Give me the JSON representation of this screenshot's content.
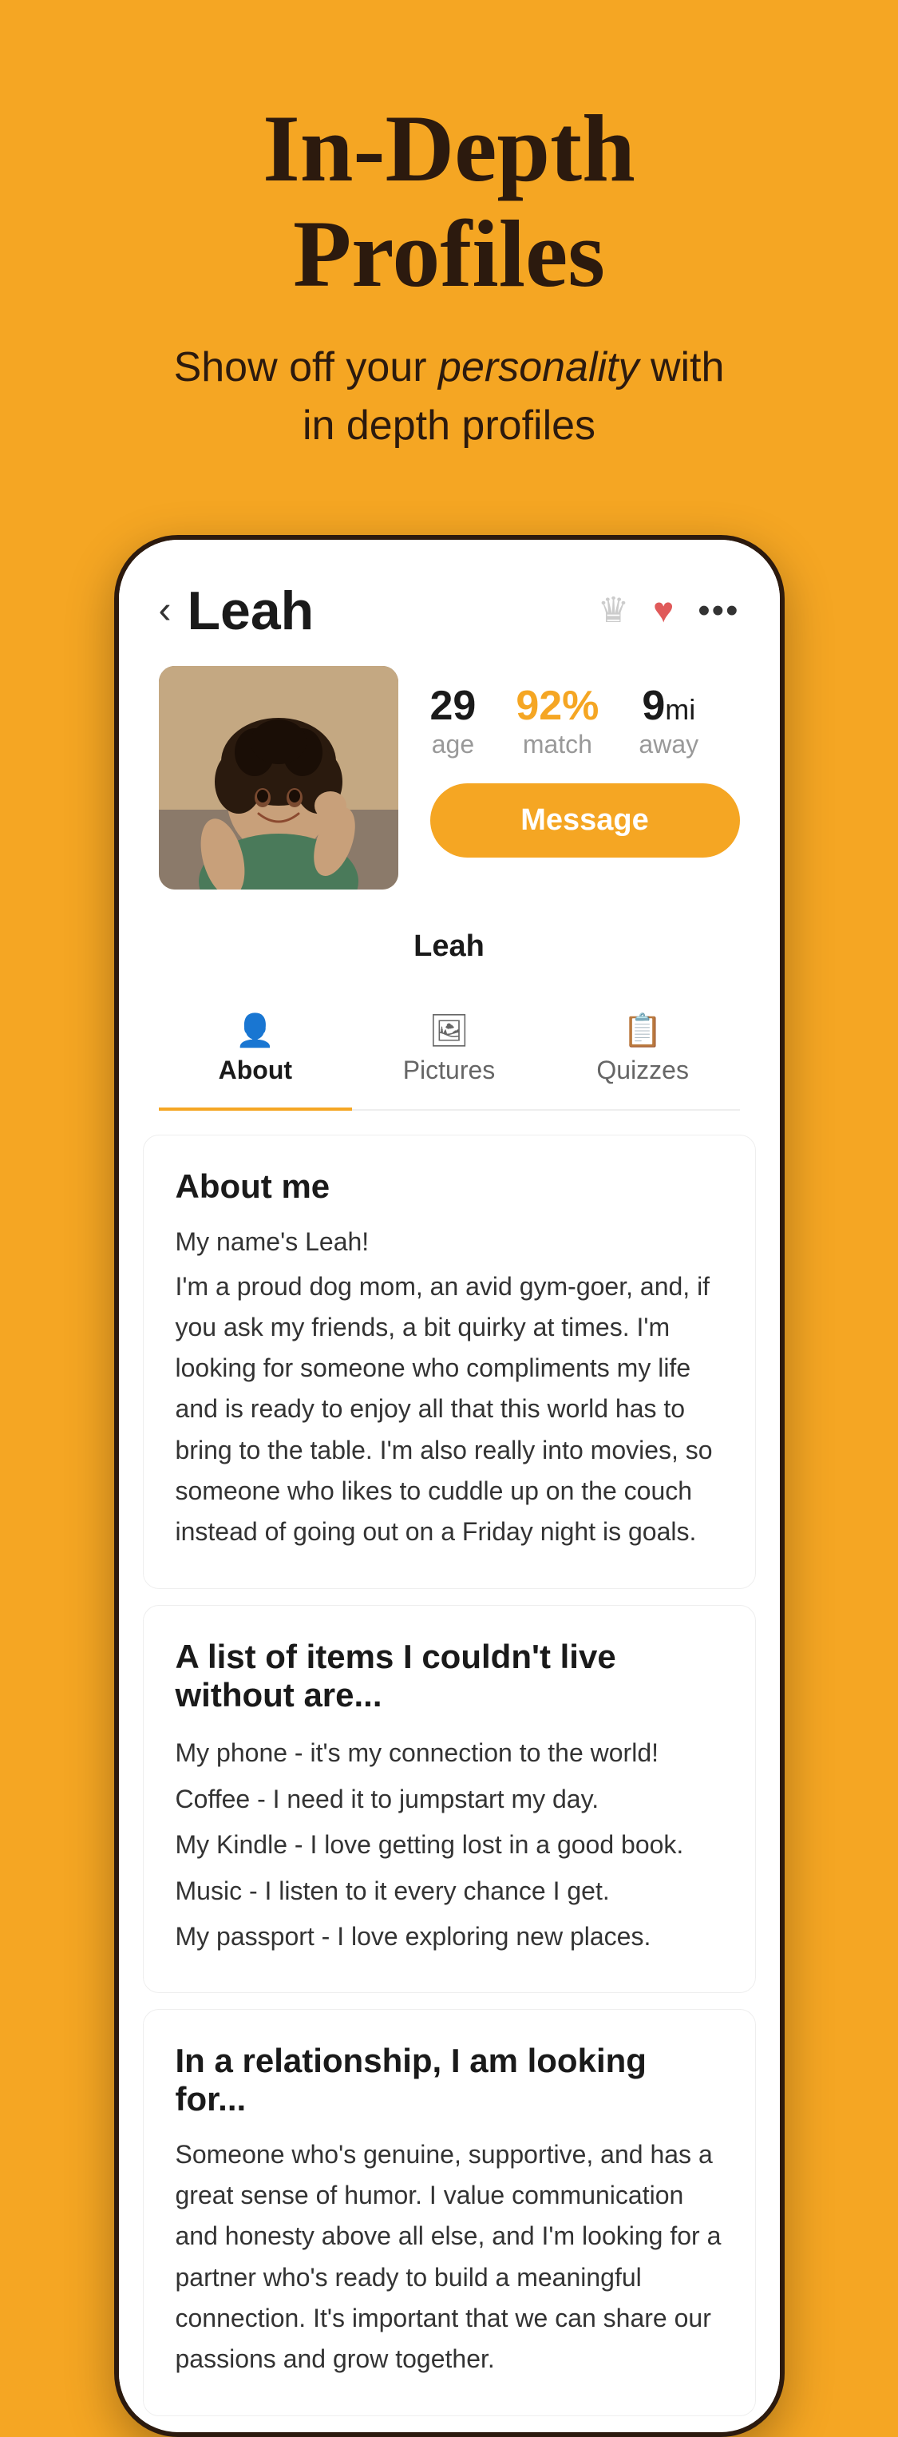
{
  "hero": {
    "title": "In-Depth\nProfiles",
    "subtitle_plain": "Show off your ",
    "subtitle_italic": "personality",
    "subtitle_end": " with\nin depth profiles"
  },
  "profile": {
    "name": "Leah",
    "age": "29",
    "age_label": "age",
    "match": "92%",
    "match_label": "match",
    "distance": "9",
    "distance_unit": "mi",
    "distance_label": "away",
    "message_button": "Message",
    "back_label": "‹",
    "more_label": "···"
  },
  "tabs": [
    {
      "label": "About",
      "icon": "👤",
      "active": true
    },
    {
      "label": "Pictures",
      "icon": "🖼",
      "active": false
    },
    {
      "label": "Quizzes",
      "icon": "📋",
      "active": false
    }
  ],
  "sections": [
    {
      "title": "About me",
      "content": "My name's Leah!\nI'm a proud dog mom, an avid gym-goer, and, if you ask my friends, a bit quirky at times. I'm looking for someone who compliments my life and is ready to enjoy all that this world has to bring to the table. I'm also really into movies, so someone who likes to cuddle up on the couch instead of going out on a Friday night is goals."
    },
    {
      "title": "A list of items I couldn't live without are...",
      "items": [
        "My phone - it's my connection to the world!",
        "Coffee - I need it to jumpstart my day.",
        "My Kindle - I love getting lost in a good book.",
        "Music - I listen to it every chance I get.",
        "My passport - I love exploring new places."
      ]
    },
    {
      "title": "In a relationship, I am looking for...",
      "content": "Someone who's genuine, supportive, and has a great sense of humor. I value communication and honesty above all else, and I'm looking for a partner who's ready to build a meaningful connection. It's important that we can share our passions and grow together."
    }
  ]
}
